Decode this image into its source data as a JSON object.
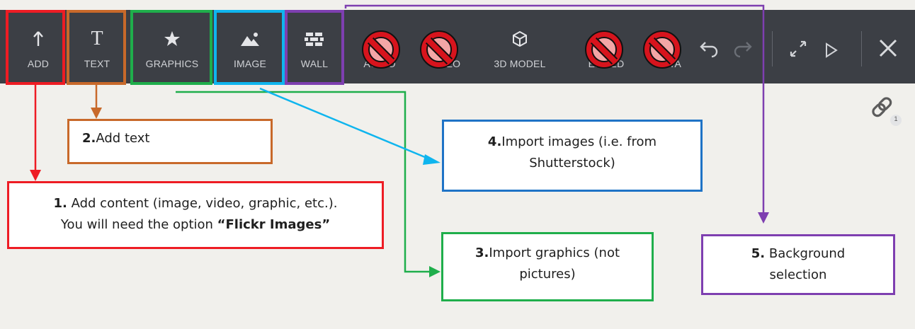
{
  "toolbar": {
    "items": [
      {
        "label": "ADD",
        "icon": "arrow-up-icon"
      },
      {
        "label": "TEXT",
        "icon": "text-t-icon",
        "glyph": "T"
      },
      {
        "label": "GRAPHICS",
        "icon": "star-icon"
      },
      {
        "label": "IMAGE",
        "icon": "image-icon"
      },
      {
        "label": "WALL",
        "icon": "bricks-icon"
      },
      {
        "label": "AUDIO",
        "icon": "audio-icon",
        "disabled_marker": true
      },
      {
        "label": "VIDEO",
        "icon": "video-icon",
        "disabled_marker": true
      },
      {
        "label": "3D MODEL",
        "icon": "cube-icon"
      },
      {
        "label": "EMBED",
        "icon": "embed-icon",
        "disabled_marker": true
      },
      {
        "label": "DATA",
        "icon": "data-icon",
        "disabled_marker": true
      }
    ],
    "controls": [
      "undo-icon",
      "redo-icon",
      "expand-icon",
      "play-icon",
      "close-icon"
    ]
  },
  "link_badge": {
    "icon": "link-icon",
    "count": "1"
  },
  "callouts": {
    "add": {
      "num": "1.",
      "line1": " Add content (image, video, graphic, etc.).",
      "line2_prefix": "You will need the option ",
      "line2_bold": "“Flickr Images”"
    },
    "text": {
      "num": "2.",
      "body": "Add text"
    },
    "graphics": {
      "num": "3.",
      "line1": "Import graphics (not",
      "line2": "pictures)"
    },
    "images": {
      "num": "4.",
      "line1": "Import images (i.e. from",
      "line2": "Shutterstock)"
    },
    "wall": {
      "num": "5.",
      "line1": " Background",
      "line2": "selection"
    }
  },
  "colors": {
    "toolbar_bg": "#3c3f45",
    "add": "#ee1c24",
    "text": "#c8692a",
    "graphics": "#1fae4b",
    "image": "#0fb5ee",
    "wall": "#7e3fb0",
    "images_box": "#1f73c6"
  }
}
